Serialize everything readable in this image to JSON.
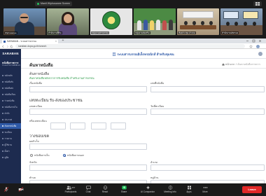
{
  "zoom": {
    "share_label": "Manit Wiphusanee Screen",
    "tiles": [
      {
        "name": "Wiphusanee"
      },
      {
        "name": "สำนักงานที่ดิน"
      },
      {
        "name": "กลุ่มงานสารบรรณ"
      },
      {
        "name": "กลุ่มงานส่งเสริม"
      },
      {
        "name": "ห้องประชุม อำเภอ"
      },
      {
        "name": "สำนักงานปกครอง"
      }
    ],
    "toolbar": {
      "participants_count": "357",
      "participants": "Participants",
      "chat": "Chat",
      "react": "React",
      "share": "Share",
      "ai": "AI Companion",
      "info": "Meeting Info",
      "apps": "Apps",
      "more": "More",
      "leave": "Leave"
    }
  },
  "browser": {
    "tab_title": "SARABAN - ระบบสารบรรณ",
    "url": "saraban.dopa.go.th/search"
  },
  "app": {
    "logo": "SARABAN",
    "header_title": "ระบบสารบรรณอิเล็กทรอนิกส์ สำหรับชุมชน",
    "sidebar": {
      "brand_line1": "หนังสือราชการ",
      "brand_line2": "ระบบสารบรรณอิเล็กทรอนิกส์",
      "items": [
        "หน้าหลัก",
        "หนังสือรับ",
        "หนังสือส่ง",
        "หนังสือเวียน",
        "ร่างหนังสือ",
        "หนังสือภายใน",
        "คำสั่ง",
        "ประกาศ",
        "ค้นหาหนังสือ",
        "ทะเบียน",
        "รายงาน",
        "ผู้ใช้งาน",
        "ตั้งค่า",
        "คู่มือ"
      ]
    },
    "page": {
      "title": "ค้นหาหนังสือ",
      "breadcrumb_home": "หน้าแรก",
      "breadcrumb_current": "ค้นหาหนังสือราชการ",
      "section1_title": "ค้นหาหนังสือ",
      "hint": "ค้นหาหนังสือหลังจากการรับหนังสือ สำหรับงานสารบรรณ",
      "subject_label": "เรื่องหนังสือ",
      "number_label": "เลขที่หนังสือ",
      "section2_title": "เลขทะเบียน รับ-ส่งของประชาชน",
      "reg_no_label": "เลขทะเบียน",
      "reg_date_label": "วันที่ทะเบียน",
      "or_reg_label": "หรือเลขทะเบียน",
      "section3_title": "วางขอบเขต",
      "result_label": "ผลสำเร็จ",
      "radio_internal": "หนังสือภายใน",
      "radio_external": "หนังสือภายนอก",
      "radio_external_checked": true,
      "province_label": "จังหวัด",
      "district_label": "อำเภอ",
      "subdistrict_label": "ตำบล",
      "village_label": "หมู่บ้าน"
    }
  },
  "colors": {
    "sidebar": "#1d2b4f",
    "accent": "#2f5aa8",
    "hint": "#2e9b4a",
    "leave": "#e02828",
    "share": "#23c55e"
  }
}
